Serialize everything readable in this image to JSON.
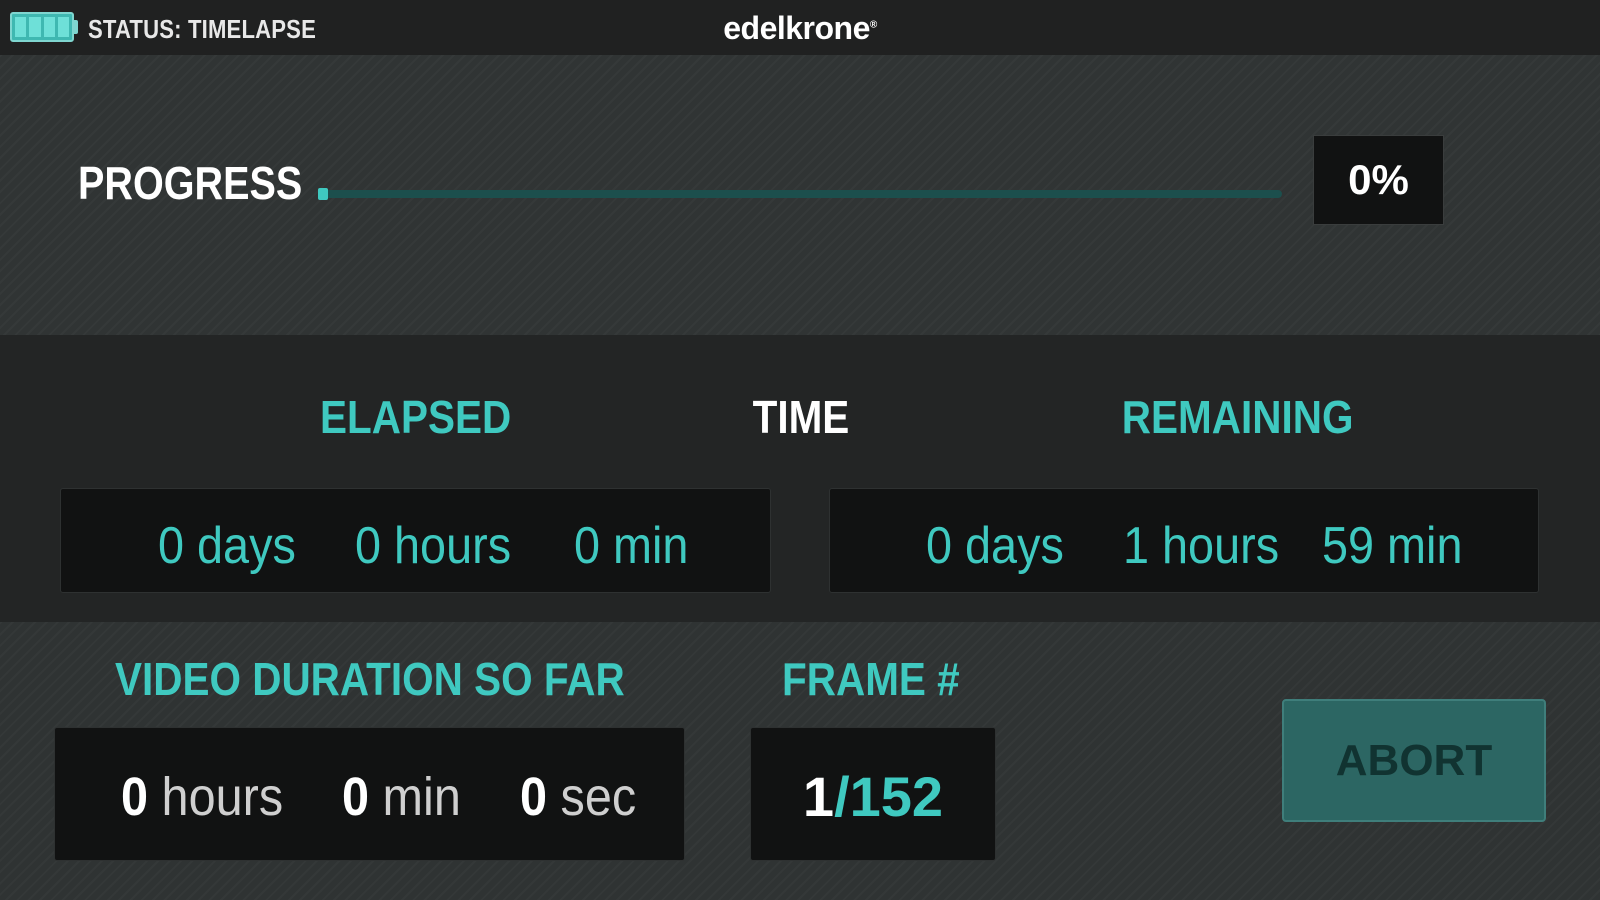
{
  "topbar": {
    "status": "STATUS: TIMELAPSE",
    "brand": "edelkrone",
    "battery_icon": "battery-full-icon"
  },
  "progress": {
    "label": "PROGRESS",
    "percent_text": "0%",
    "value": 0
  },
  "time": {
    "elapsed_label": "ELAPSED",
    "time_label": "TIME",
    "remaining_label": "REMAINING",
    "elapsed": {
      "days": "0 days",
      "hours": "0 hours",
      "min": "0 min"
    },
    "remaining": {
      "days": "0 days",
      "hours": "1 hours",
      "min": "59 min"
    }
  },
  "video": {
    "label": "VIDEO DURATION SO FAR",
    "hours_value": "0",
    "hours_unit": "hours",
    "min_value": "0",
    "min_unit": "min",
    "sec_value": "0",
    "sec_unit": "sec"
  },
  "frame": {
    "label": "FRAME #",
    "current": "1",
    "total": "/152"
  },
  "abort_label": "ABORT",
  "colors": {
    "accent": "#3fc9c0",
    "background": "#2a2c2c",
    "box": "#111212",
    "abort_button": "#2c6663"
  }
}
